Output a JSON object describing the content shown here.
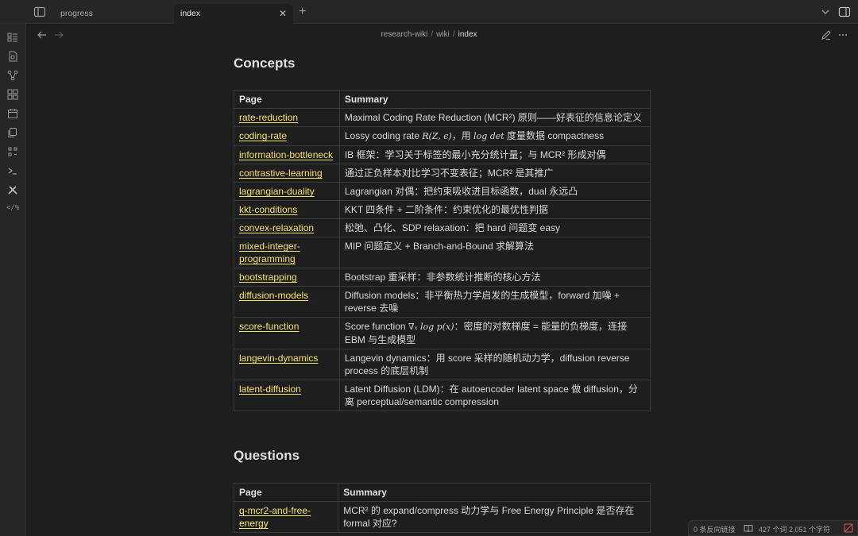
{
  "tabs": [
    {
      "label": "progress",
      "active": false
    },
    {
      "label": "index",
      "active": true
    }
  ],
  "breadcrumb": [
    "research-wiki",
    "wiki",
    "index"
  ],
  "sections": {
    "concepts": {
      "heading": "Concepts",
      "header": [
        "Page",
        "Summary"
      ],
      "rows": [
        {
          "page": "rate-reduction",
          "summary": "Maximal Coding Rate Reduction (MCR²) 原则——好表征的信息论定义"
        },
        {
          "page": "coding-rate",
          "summary_pre": "Lossy coding rate ",
          "summary_math1": "R(Z, ϵ)",
          "summary_mid": "，用 ",
          "summary_math2": "log det",
          "summary_post": " 度量数据 compactness"
        },
        {
          "page": "information-bottleneck",
          "summary": "IB 框架：学习关于标签的最小充分统计量；与 MCR² 形成对偶"
        },
        {
          "page": "contrastive-learning",
          "summary": "通过正负样本对比学习不变表征；MCR² 是其推广"
        },
        {
          "page": "lagrangian-duality",
          "summary": "Lagrangian 对偶：把约束吸收进目标函数，dual 永远凸"
        },
        {
          "page": "kkt-conditions",
          "summary": "KKT 四条件 + 二阶条件：约束优化的最优性判据"
        },
        {
          "page": "convex-relaxation",
          "summary": "松弛、凸化、SDP relaxation：把 hard 问题变 easy"
        },
        {
          "page": "mixed-integer-programming",
          "summary": "MIP 问题定义 + Branch-and-Bound 求解算法"
        },
        {
          "page": "bootstrapping",
          "summary": "Bootstrap 重采样：非参数统计推断的核心方法"
        },
        {
          "page": "diffusion-models",
          "summary": "Diffusion models：非平衡热力学启发的生成模型，forward 加噪 + reverse 去噪"
        },
        {
          "page": "score-function",
          "summary_pre": "Score function ",
          "summary_math1": "∇ₓ log p(x)",
          "summary_post": "：密度的对数梯度 = 能量的负梯度，连接 EBM 与生成模型"
        },
        {
          "page": "langevin-dynamics",
          "summary": "Langevin dynamics：用 score 采样的随机动力学，diffusion reverse process 的底层机制"
        },
        {
          "page": "latent-diffusion",
          "summary": "Latent Diffusion (LDM)：在 autoencoder latent space 做 diffusion，分离 perceptual/semantic compression"
        }
      ]
    },
    "questions": {
      "heading": "Questions",
      "header": [
        "Page",
        "Summary"
      ],
      "rows": [
        {
          "page": "q-mcr2-and-free-energy",
          "summary": "MCR² 的 expand/compress 动力学与 Free Energy Principle 是否存在 formal 对应?"
        }
      ]
    }
  },
  "statusbar": {
    "backlinks": "0 条反向链接",
    "counts": "427 个词  2,051 个字符"
  },
  "colors": {
    "link": "#f5e26a",
    "background": "#1e1e1e",
    "chrome": "#262626"
  },
  "icons": [
    "sidebar-toggle-icon",
    "close-icon",
    "plus-icon",
    "chevron-down-icon",
    "right-sidebar-toggle-icon",
    "files-icon",
    "new-note-icon",
    "graph-icon",
    "canvas-icon",
    "calendar-icon",
    "templates-icon",
    "command-icon",
    "terminal-icon",
    "tools-icon",
    "code-icon",
    "back-arrow-icon",
    "forward-arrow-icon",
    "edit-icon",
    "more-icon",
    "book-icon",
    "sync-icon"
  ]
}
